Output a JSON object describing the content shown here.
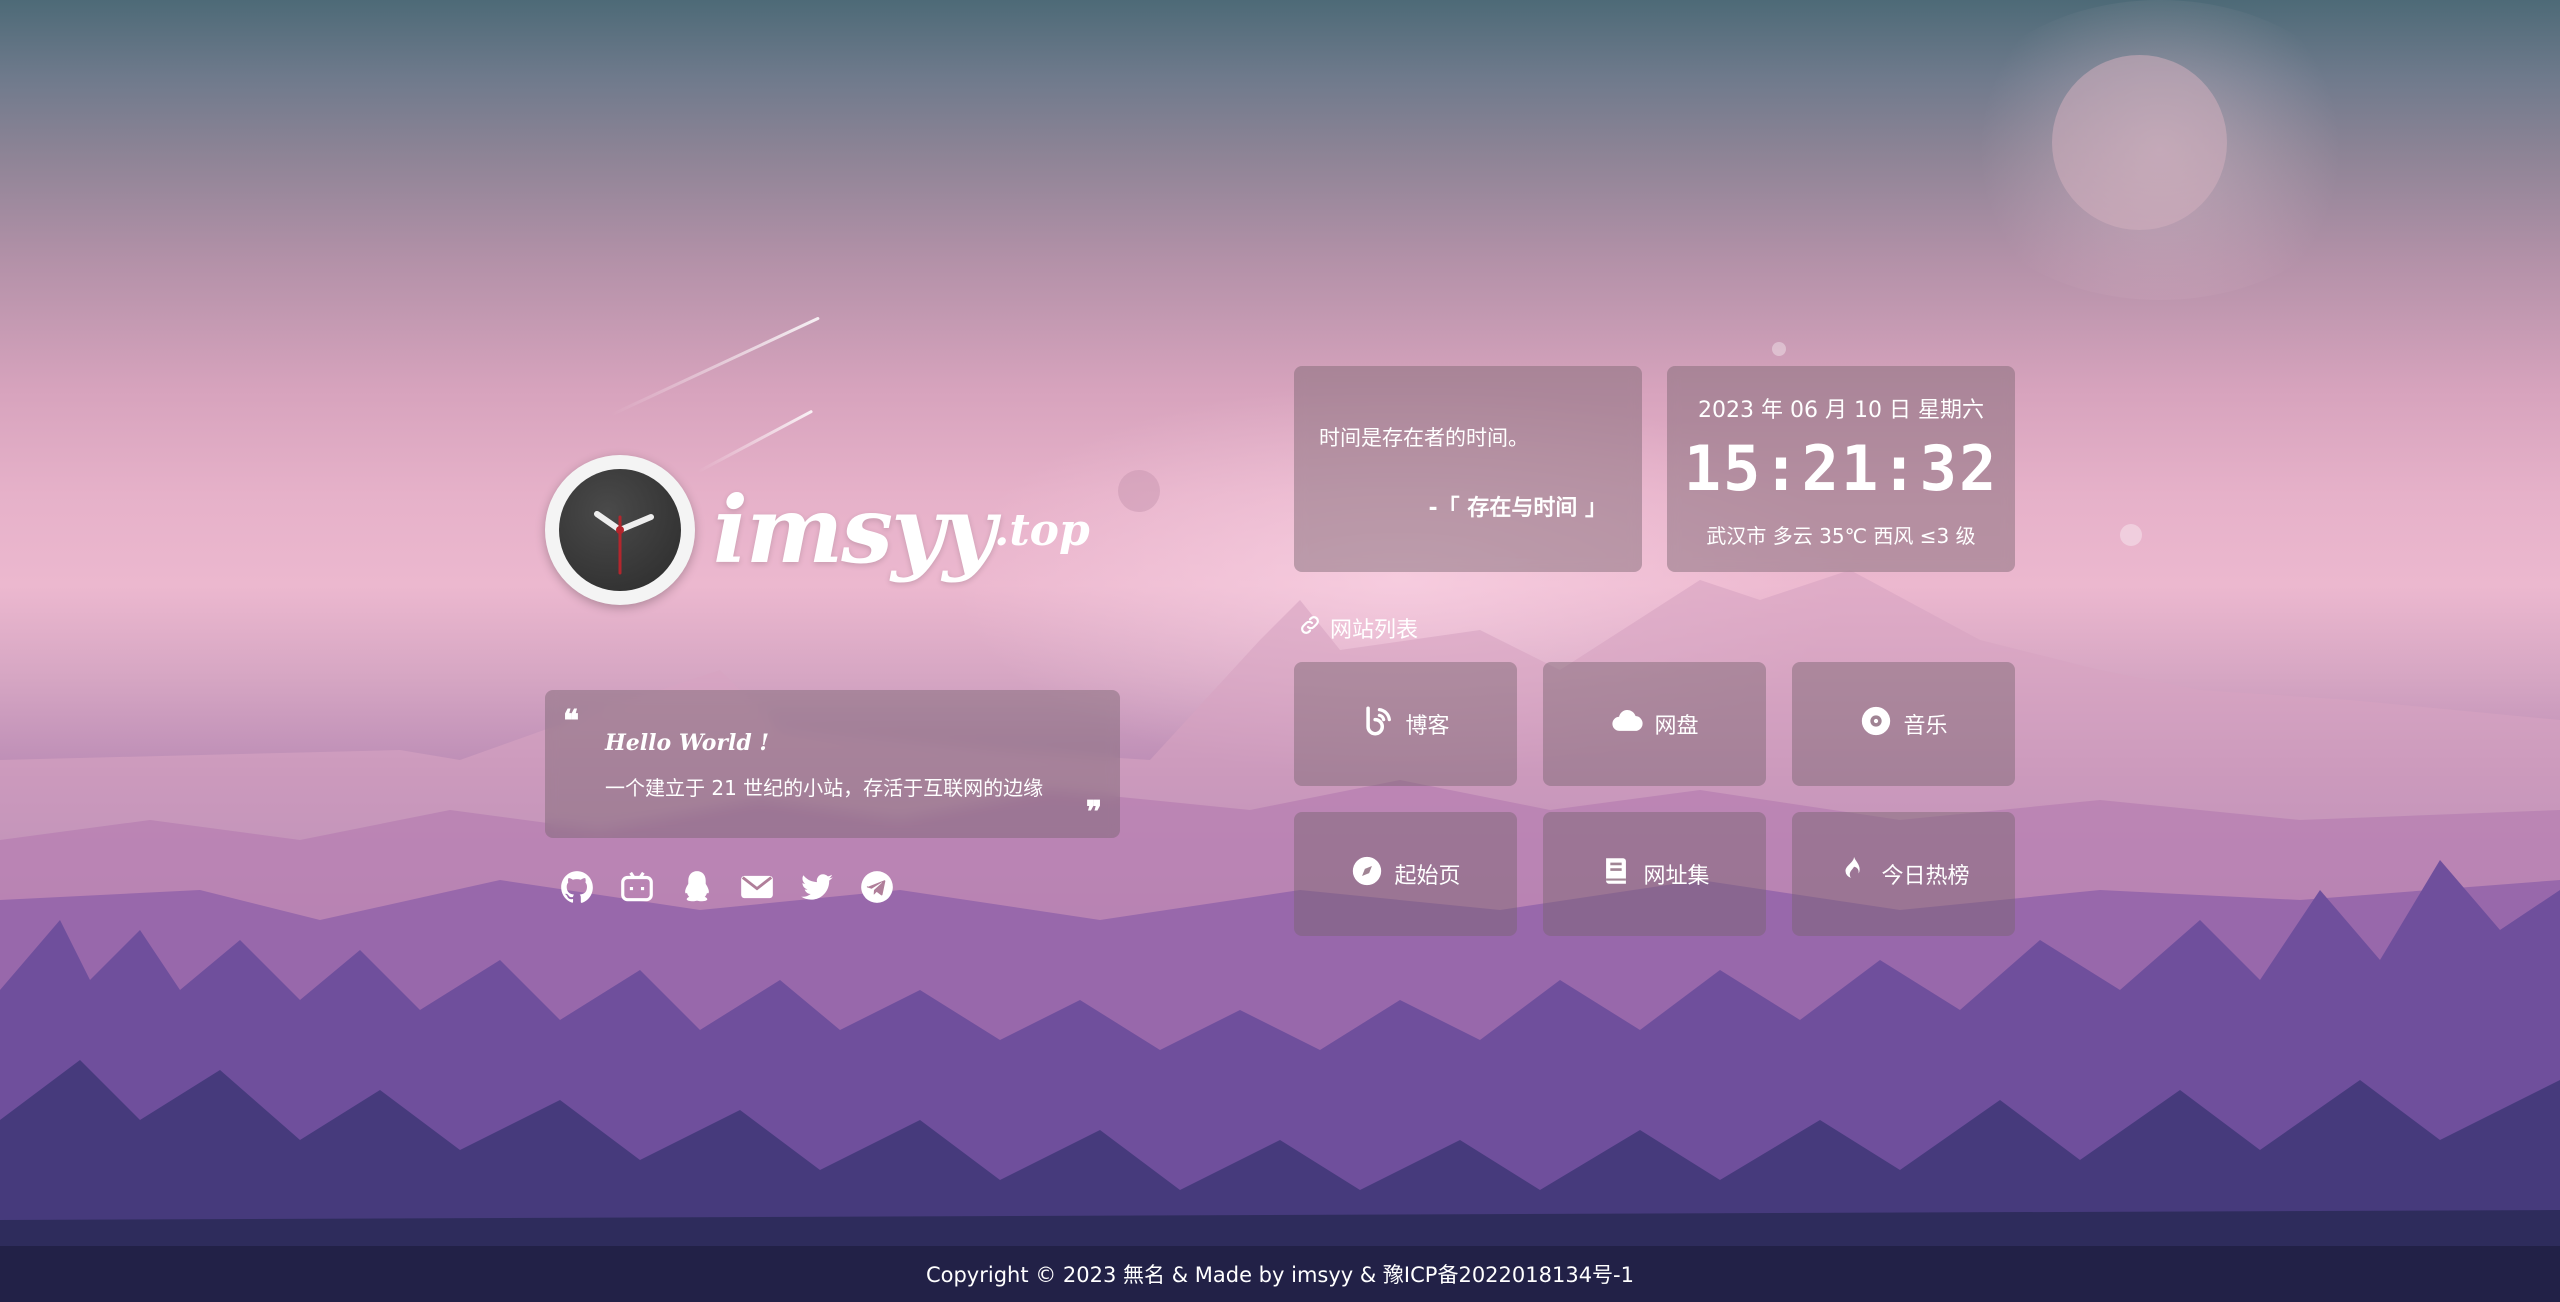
{
  "logo": {
    "name": "imsyy",
    "suffix": ".top"
  },
  "intro": {
    "hello": "Hello World !",
    "line": "一个建立于 21 世纪的小站，存活于互联网的边缘",
    "quote_open": "❝",
    "quote_close": "❞"
  },
  "social": [
    "github-icon",
    "bilibili-icon",
    "qq-icon",
    "mail-icon",
    "twitter-icon",
    "telegram-icon"
  ],
  "hitokoto": {
    "text": "时间是存在者的时间。",
    "from": "-「 存在与时间 」"
  },
  "clock": {
    "date": "2023 年 06 月 10 日 星期六",
    "time": "15:21:32",
    "weather": "武汉市 多云 35℃ 西风 ≤3 级"
  },
  "sites": {
    "title": "网站列表",
    "items": [
      {
        "label": "博客",
        "icon": "blog-icon"
      },
      {
        "label": "网盘",
        "icon": "cloud-icon"
      },
      {
        "label": "音乐",
        "icon": "music-icon"
      },
      {
        "label": "起始页",
        "icon": "compass-icon"
      },
      {
        "label": "网址集",
        "icon": "book-icon"
      },
      {
        "label": "今日热榜",
        "icon": "fire-icon"
      }
    ]
  },
  "footer": {
    "copyright": "Copyright © 2023 無名 & Made by imsyy & 豫ICP备2022018134号-1"
  }
}
